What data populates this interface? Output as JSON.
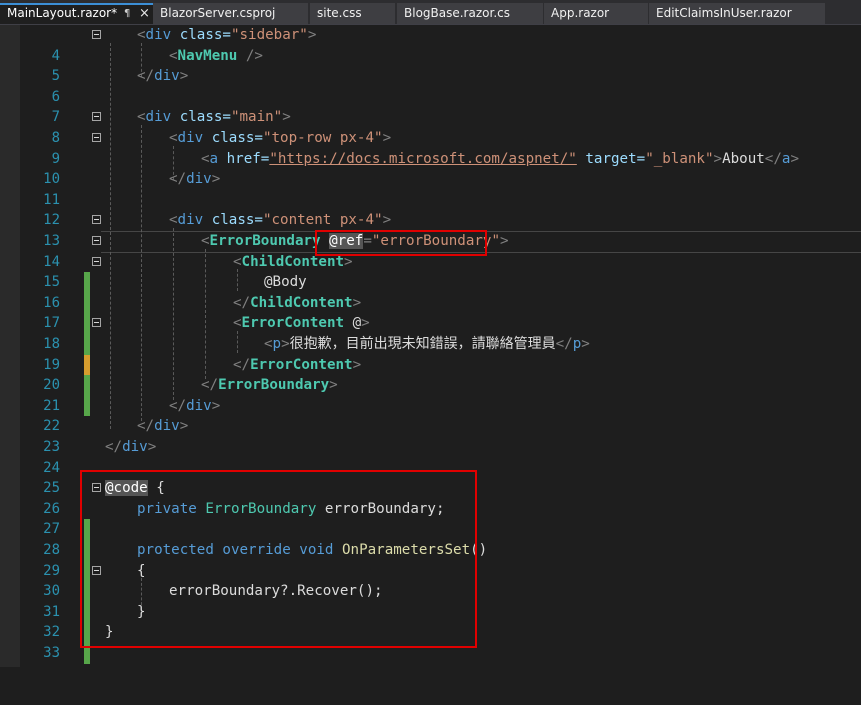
{
  "tabs": [
    {
      "label": "MainLayout.razor*",
      "active": true
    },
    {
      "label": "BlazorServer.csproj"
    },
    {
      "label": "site.css"
    },
    {
      "label": "BlogBase.razor.cs"
    },
    {
      "label": "App.razor"
    },
    {
      "label": "EditClaimsInUser.razor"
    }
  ],
  "tab_icons": {
    "pin": "pin-icon",
    "close": "close-icon",
    "pin_glyph": "¶",
    "close_glyph": "×"
  },
  "colors": {
    "line_number": "#2b91af",
    "tag": "#569cd6",
    "component": "#4ec9b0",
    "attribute": "#9cdcfe",
    "string": "#ce9178",
    "saved_change": "#57a64a",
    "unsaved_change": "#d69d2e",
    "highlight_box": "#e00000"
  },
  "line_numbers": [
    "4",
    "5",
    "6",
    "7",
    "8",
    "9",
    "10",
    "11",
    "12",
    "13",
    "14",
    "15",
    "16",
    "17",
    "18",
    "19",
    "20",
    "21",
    "22",
    "23",
    "24",
    "25",
    "26",
    "27",
    "28",
    "29",
    "30",
    "31",
    "32",
    "33"
  ],
  "tokens": {
    "lt": "<",
    "lt_slash": "</",
    "gt": ">",
    "self_close": " />",
    "div": "div",
    "a": "a",
    "p": "p",
    "class_attr": " class=",
    "href_attr": " href=",
    "target_attr": " target=",
    "ref_eq": "=",
    "sidebar_str": "\"sidebar\"",
    "main_str": "\"main\"",
    "toprow_str": "\"top-row px-4\"",
    "href_str": "\"https://docs.microsoft.com/aspnet/\"",
    "blank_str": "\"_blank\"",
    "content_str": "\"content px-4\"",
    "ref_str": "\"errorBoundary\"",
    "navmenu": "NavMenu",
    "about": "About",
    "error_boundary": "ErrorBoundary",
    "ref_directive": "@ref",
    "child_content": "ChildContent",
    "body": "@Body",
    "error_content": "ErrorContent",
    "at_sign": "@",
    "error_message": "很抱歉，目前出現未知錯誤，請聯絡管理員",
    "code_directive": "@code",
    "open_brace": " {",
    "brace_open": "{",
    "brace_close": "}",
    "private_kw": "private",
    "field_decl": " errorBoundary;",
    "protected_kw": "protected",
    "override_kw": " override",
    "void_kw": " void",
    "method_name": " OnParametersSet",
    "parens": "()",
    "recover_call": "errorBoundary?.Recover();"
  }
}
